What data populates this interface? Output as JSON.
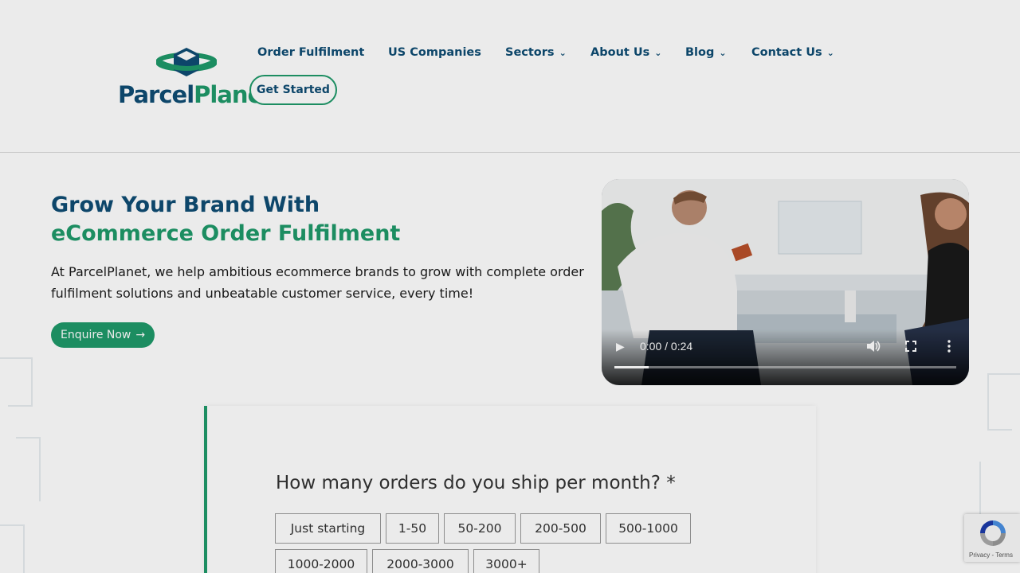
{
  "brand": {
    "part1": "Parcel",
    "part2": "Planet",
    "color_blue": "#0f4d73",
    "color_green": "#1f9a6a"
  },
  "nav": {
    "items": [
      {
        "label": "Order Fulfilment",
        "has_dropdown": false
      },
      {
        "label": "US Companies",
        "has_dropdown": false
      },
      {
        "label": "Sectors",
        "has_dropdown": true
      },
      {
        "label": "About Us",
        "has_dropdown": true
      },
      {
        "label": "Blog",
        "has_dropdown": true
      },
      {
        "label": "Contact Us",
        "has_dropdown": true
      }
    ],
    "cta": "Get Started"
  },
  "hero": {
    "title_line1": "Grow Your Brand With",
    "title_line2": "eCommerce Order Fulfilment",
    "description": "At ParcelPlanet, we help ambitious ecommerce brands to grow with complete order fulfilment solutions and unbeatable customer service, every time!",
    "button": "Enquire Now",
    "button_icon": "arrow-right-icon"
  },
  "video": {
    "time": "0:00 / 0:24",
    "progress": 0.1
  },
  "form": {
    "question": "How many orders do you ship per month? *",
    "options": [
      "Just starting",
      "1-50",
      "50-200",
      "200-500",
      "500-1000",
      "1000-2000",
      "2000-3000",
      "3000+"
    ]
  },
  "recaptcha": {
    "text": "Privacy - Terms"
  }
}
